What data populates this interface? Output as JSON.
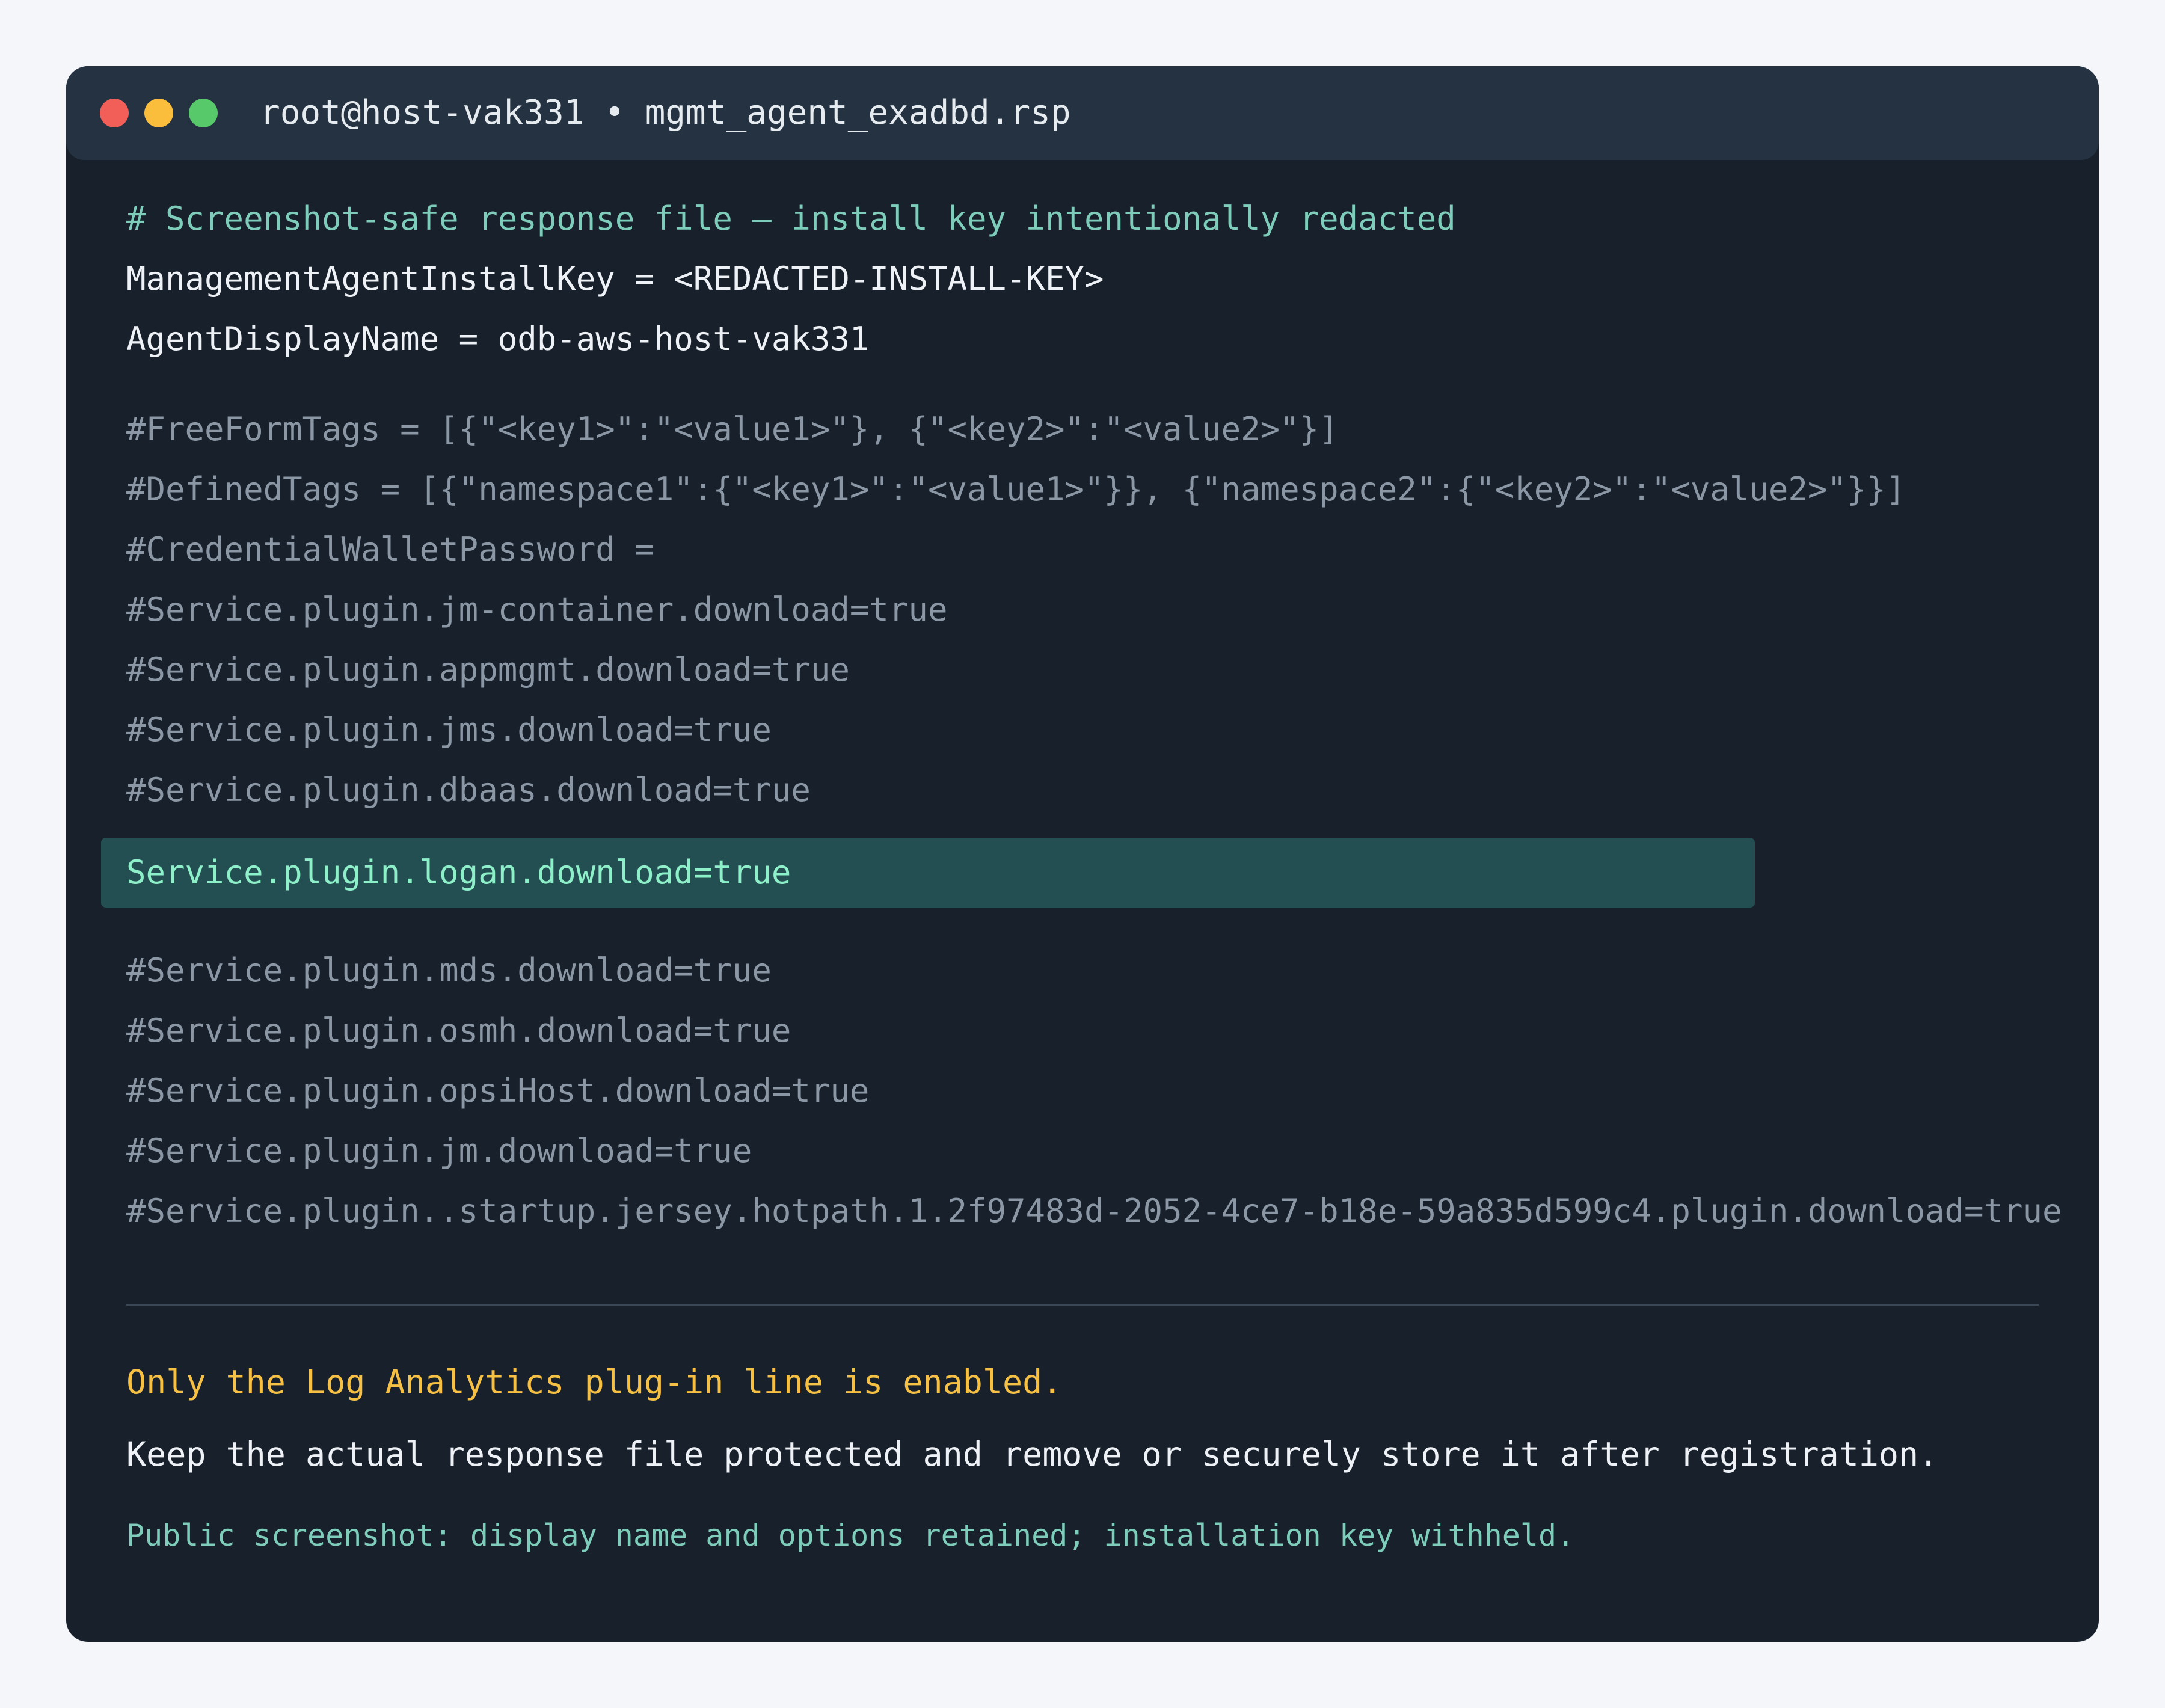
{
  "window": {
    "title": "root@host-vak331 • mgmt_agent_exadbd.rsp",
    "controls": {
      "close_color": "#f25f58",
      "minimize_color": "#fbbe3c",
      "maximize_color": "#58c96b"
    }
  },
  "file": {
    "header_comment": "# Screenshot-safe response file — install key intentionally redacted",
    "install_key_line": "ManagementAgentInstallKey = <REDACTED-INSTALL-KEY>",
    "display_name_line": "AgentDisplayName = odb-aws-host-vak331",
    "commented_options": [
      "#FreeFormTags = [{\"<key1>\":\"<value1>\"}, {\"<key2>\":\"<value2>\"}]",
      "#DefinedTags = [{\"namespace1\":{\"<key1>\":\"<value1>\"}}, {\"namespace2\":{\"<key2>\":\"<value2>\"}}]",
      "#CredentialWalletPassword =",
      "#Service.plugin.jm-container.download=true",
      "#Service.plugin.appmgmt.download=true",
      "#Service.plugin.jms.download=true",
      "#Service.plugin.dbaas.download=true"
    ],
    "enabled_line": "Service.plugin.logan.download=true",
    "commented_plugins_after": [
      "#Service.plugin.mds.download=true",
      "#Service.plugin.osmh.download=true",
      "#Service.plugin.opsiHost.download=true",
      "#Service.plugin.jm.download=true",
      "#Service.plugin..startup.jersey.hotpath.1.2f97483d-2052-4ce7-b18e-59a835d599c4.plugin.download=true"
    ]
  },
  "notes": {
    "warning": "Only the Log Analytics plug-in line is enabled.",
    "advice": "Keep the actual response file protected and remove or securely store it after registration.",
    "footer": "Public screenshot: display name and options retained; installation key withheld."
  },
  "colors": {
    "page_background": "#f4f6fa",
    "terminal_background": "#17202b",
    "titlebar_background": "#243241",
    "comment": "#7ecdbb",
    "active_text": "#eef2f6",
    "muted_text": "#8b97a5",
    "enabled_highlight": "#244f52",
    "enabled_text": "#8ef0c9",
    "warning_text": "#f6c044"
  }
}
